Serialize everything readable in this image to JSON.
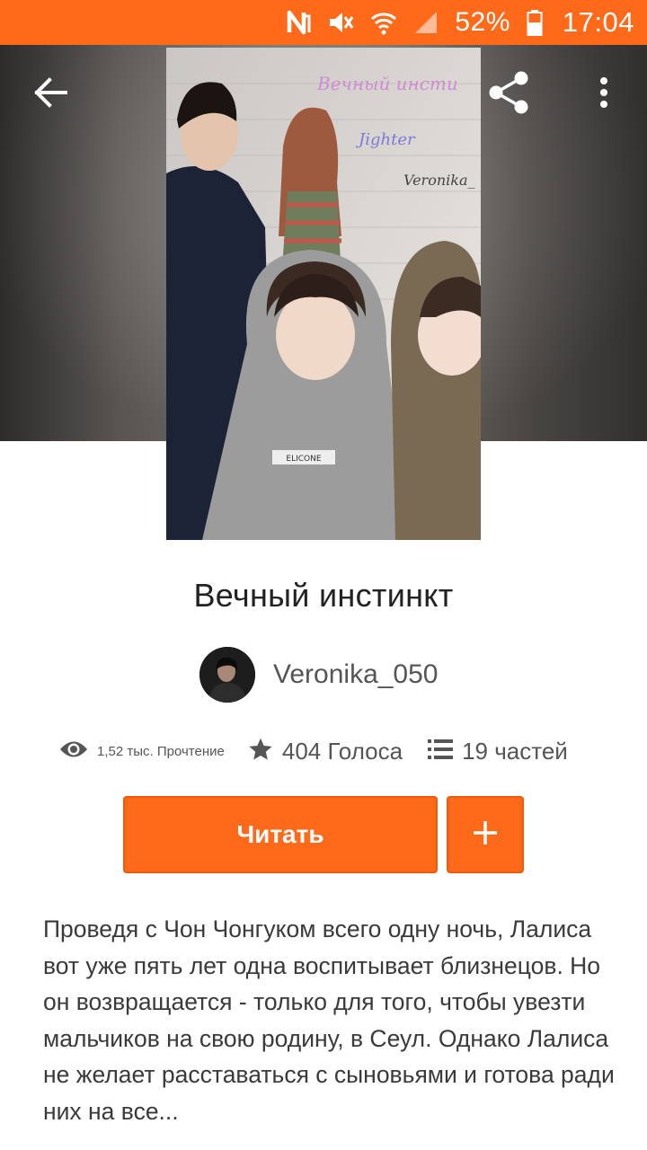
{
  "status_bar": {
    "icons": [
      "nfc-icon",
      "mute-icon",
      "wifi-icon",
      "signal-icon",
      "battery-icon"
    ],
    "battery_percent": "52%",
    "time": "17:04"
  },
  "toolbar": {
    "back_icon": "arrow-left-icon",
    "share_icon": "share-icon",
    "more_icon": "more-vertical-icon"
  },
  "cover": {
    "title_text": "Вечный инсти",
    "subtitle_text": "Jighter",
    "author_text": "Veronika_",
    "badge_text": "ELICONE"
  },
  "story": {
    "title": "Вечный инстинкт",
    "author": "Veronika_050",
    "reads": "1,52 тыс. Прочтение",
    "votes": "404 Голоса",
    "parts": "19 частей",
    "description": "Проведя с  Чон Чонгуком всего одну ночь, Лалиса вот уже пять лет одна воспитывает близнецов. Но он возвращается - только для того, чтобы увезти мальчиков на свою родину, в Сеул. Однако Лалиса не желает расставаться с сыновьями и готова ради них на все..."
  },
  "actions": {
    "read_label": "Читать",
    "add_icon": "plus-icon"
  },
  "colors": {
    "accent": "#ff6a1a",
    "text": "#222222",
    "muted": "#555555"
  }
}
